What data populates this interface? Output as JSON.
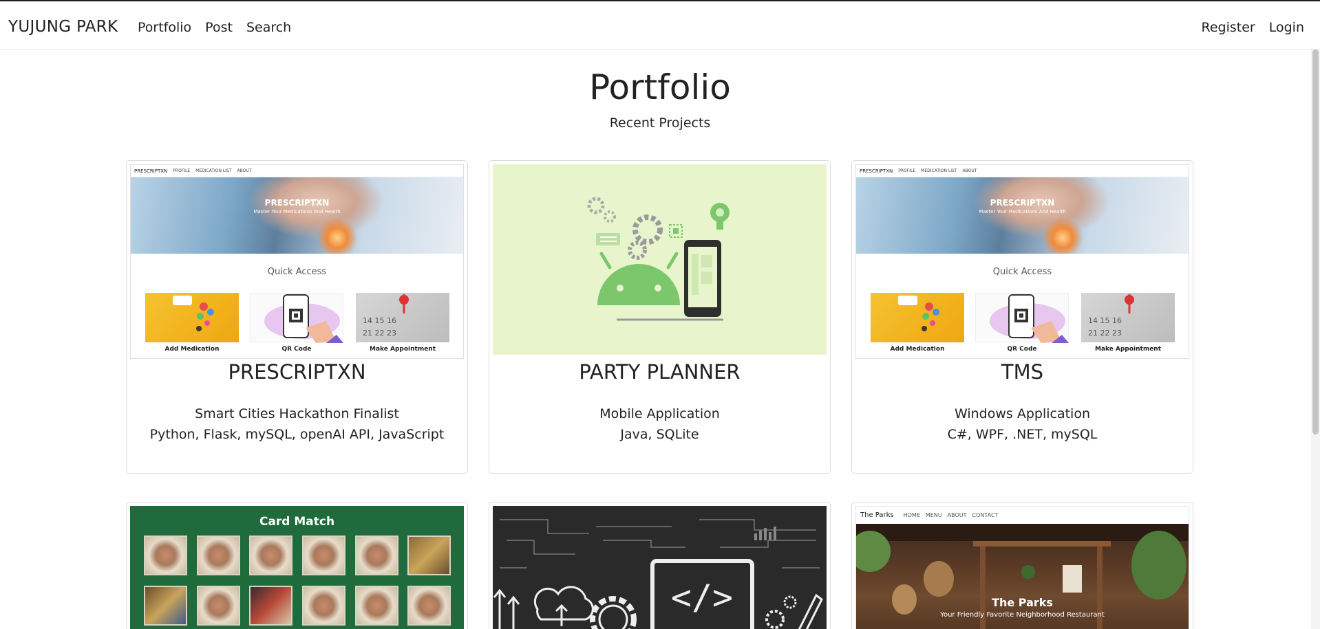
{
  "nav": {
    "brand": "YUJUNG PARK",
    "links": [
      "Portfolio",
      "Post",
      "Search"
    ],
    "right": [
      "Register",
      "Login"
    ]
  },
  "header": {
    "title": "Portfolio",
    "subtitle": "Recent Projects"
  },
  "projects": [
    {
      "title": "PRESCRIPTXN",
      "line1": "Smart Cities Hackathon Finalist",
      "line2": "Python, Flask, mySQL, openAI API, JavaScript",
      "thumb": {
        "nav": [
          "PRESCRIPTXN",
          "PROFILE",
          "MEDICATION LIST",
          "ABOUT"
        ],
        "hero_title": "PRESCRIPTXN",
        "hero_tagline": "Master Your Medications And Health",
        "quick_access": "Quick Access",
        "tiles": [
          "Add Medication",
          "QR Code",
          "Make Appointment"
        ]
      }
    },
    {
      "title": "PARTY PLANNER",
      "line1": "Mobile Application",
      "line2": "Java, SQLite"
    },
    {
      "title": "TMS",
      "line1": "Windows Application",
      "line2": "C#, WPF, .NET, mySQL",
      "thumb": {
        "nav": [
          "PRESCRIPTXN",
          "PROFILE",
          "MEDICATION LIST",
          "ABOUT"
        ],
        "hero_title": "PRESCRIPTXN",
        "hero_tagline": "Master Your Medications And Health",
        "quick_access": "Quick Access",
        "tiles": [
          "Add Medication",
          "QR Code",
          "Make Appointment"
        ]
      }
    },
    {
      "thumb": {
        "title": "Card Match"
      }
    },
    {
      "thumb": {
        "code_symbol": "</>"
      }
    },
    {
      "thumb": {
        "brand": "The Parks",
        "nav": [
          "HOME",
          "MENU",
          "ABOUT",
          "CONTACT"
        ],
        "title": "The Parks",
        "tagline": "Your Friendly Favorite Neighborhood Restaurant"
      }
    }
  ]
}
